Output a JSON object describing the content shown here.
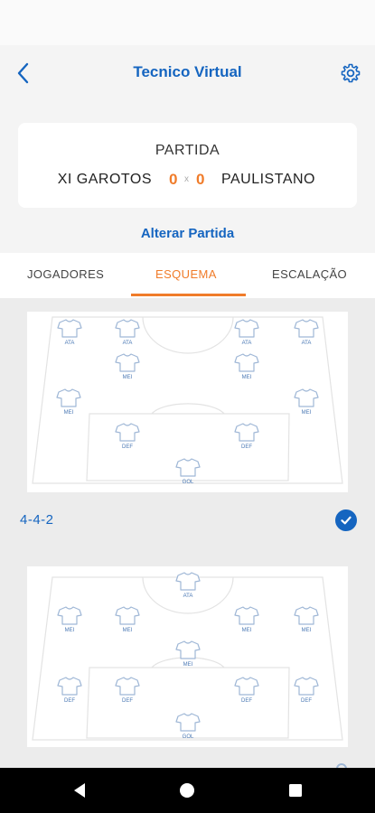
{
  "header": {
    "title": "Tecnico Virtual",
    "back_icon": "chevron-left-icon",
    "settings_icon": "gear-icon"
  },
  "match": {
    "label": "PARTIDA",
    "home_team": "XI GAROTOS",
    "home_score": "0",
    "separator": "x",
    "away_score": "0",
    "away_team": "PAULISTANO",
    "change_label": "Alterar Partida"
  },
  "tabs": [
    {
      "label": "JOGADORES"
    },
    {
      "label": "ESQUEMA",
      "active": true
    },
    {
      "label": "ESCALAÇÃO"
    }
  ],
  "formations": [
    {
      "name": "4-4-2",
      "selected": true,
      "positions": [
        "ATA",
        "ATA",
        "ATA",
        "ATA",
        "MEI",
        "MEI",
        "MEI",
        "MEI",
        "DEF",
        "DEF",
        "GOL"
      ]
    },
    {
      "name": "",
      "selected": false,
      "positions": [
        "ATA",
        "MEI",
        "MEI",
        "MEI",
        "MEI",
        "MEI",
        "DEF",
        "DEF",
        "DEF",
        "DEF",
        "GOL"
      ]
    }
  ],
  "colors": {
    "accent_blue": "#1565c0",
    "accent_orange": "#f07c2a",
    "shirt_blue": "#9fb7d6"
  }
}
